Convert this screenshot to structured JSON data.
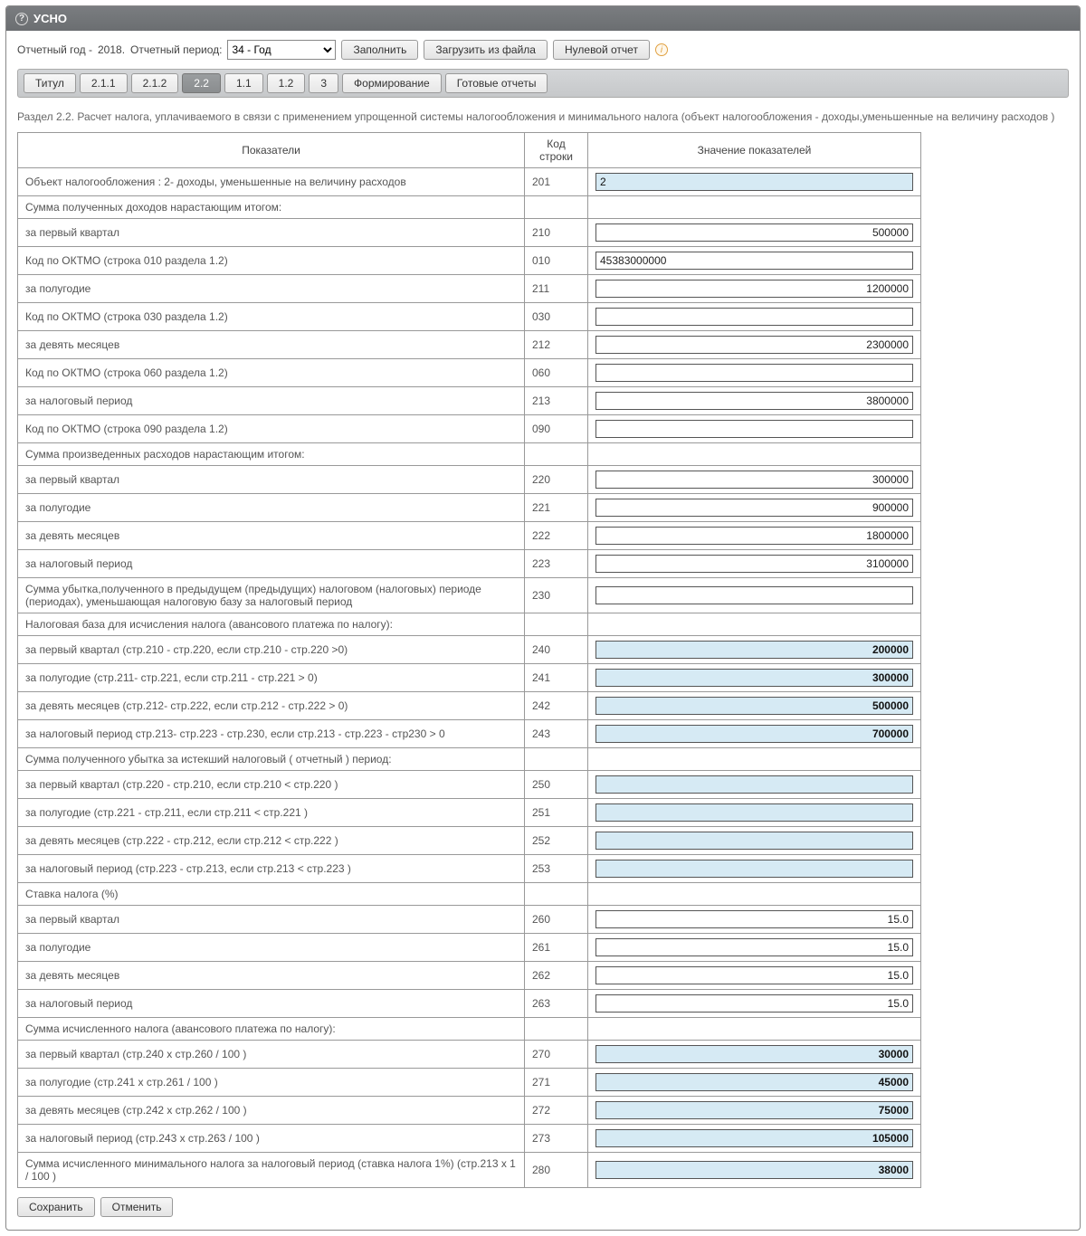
{
  "header": {
    "title": "УСНО"
  },
  "toolbar": {
    "year_label": "Отчетный год -",
    "year_value": "2018.",
    "period_label": "Отчетный период:",
    "period_selected": "34 - Год",
    "fill": "Заполнить",
    "load": "Загрузить из файла",
    "zero": "Нулевой отчет"
  },
  "tabs": [
    "Титул",
    "2.1.1",
    "2.1.2",
    "2.2",
    "1.1",
    "1.2",
    "3",
    "Формирование",
    "Готовые отчеты"
  ],
  "active_tab": "2.2",
  "section_title": "Раздел 2.2. Расчет налога, уплачиваемого в связи с применением упрощенной системы налогообложения и минимального налога (объект налогообложения - доходы,уменьшенные на величину расходов )",
  "cols": {
    "indicator": "Показатели",
    "code": "Код строки",
    "value": "Значение показателей"
  },
  "rows": [
    {
      "ind": "Объект налогообложения : 2- доходы, уменьшенные на величину расходов",
      "code": "201",
      "val": "2",
      "kind": "ro-left"
    },
    {
      "ind": "Сумма полученных доходов нарастающим итогом:",
      "code": "",
      "val": "",
      "kind": "header"
    },
    {
      "ind": "за первый квартал",
      "code": "210",
      "val": "500000",
      "kind": "edit-right"
    },
    {
      "ind": "Код по ОКТМО (строка 010 раздела 1.2)",
      "code": "010",
      "val": "45383000000",
      "kind": "edit-left"
    },
    {
      "ind": "за полугодие",
      "code": "211",
      "val": "1200000",
      "kind": "edit-right"
    },
    {
      "ind": "Код по ОКТМО (строка 030 раздела 1.2)",
      "code": "030",
      "val": "",
      "kind": "edit-left"
    },
    {
      "ind": "за девять месяцев",
      "code": "212",
      "val": "2300000",
      "kind": "edit-right"
    },
    {
      "ind": "Код по ОКТМО (строка 060 раздела 1.2)",
      "code": "060",
      "val": "",
      "kind": "edit-left"
    },
    {
      "ind": "за налоговый период",
      "code": "213",
      "val": "3800000",
      "kind": "edit-right"
    },
    {
      "ind": "Код по ОКТМО (строка 090 раздела 1.2)",
      "code": "090",
      "val": "",
      "kind": "edit-left"
    },
    {
      "ind": "Сумма произведенных расходов нарастающим итогом:",
      "code": "",
      "val": "",
      "kind": "header"
    },
    {
      "ind": "за первый квартал",
      "code": "220",
      "val": "300000",
      "kind": "edit-right"
    },
    {
      "ind": "за полугодие",
      "code": "221",
      "val": "900000",
      "kind": "edit-right"
    },
    {
      "ind": "за девять месяцев",
      "code": "222",
      "val": "1800000",
      "kind": "edit-right"
    },
    {
      "ind": "за налоговый период",
      "code": "223",
      "val": "3100000",
      "kind": "edit-right"
    },
    {
      "ind": "Сумма убытка,полученного в предыдущем (предыдущих) налоговом (налоговых) периоде (периодах), уменьшающая налоговую базу за налоговый период",
      "code": "230",
      "val": "",
      "kind": "edit-left"
    },
    {
      "ind": "Налоговая база для исчисления налога (авансового платежа по налогу):",
      "code": "",
      "val": "",
      "kind": "header"
    },
    {
      "ind": "за первый квартал (стр.210 - стр.220, если стр.210 - стр.220 >0)",
      "code": "240",
      "val": "200000",
      "kind": "ro-right"
    },
    {
      "ind": "за полугодие (стр.211- стр.221, если стр.211 - стр.221 > 0)",
      "code": "241",
      "val": "300000",
      "kind": "ro-right"
    },
    {
      "ind": "за девять месяцев (стр.212- стр.222, если стр.212 - стр.222 > 0)",
      "code": "242",
      "val": "500000",
      "kind": "ro-right"
    },
    {
      "ind": "за налоговый период стр.213- стр.223 - стр.230, если стр.213 - стр.223 - стр230 > 0",
      "code": "243",
      "val": "700000",
      "kind": "ro-right"
    },
    {
      "ind": "Сумма полученного убытка за истекший налоговый ( отчетный ) период:",
      "code": "",
      "val": "",
      "kind": "header"
    },
    {
      "ind": "за первый квартал (стр.220 - стр.210, если стр.210 < стр.220 )",
      "code": "250",
      "val": "",
      "kind": "ro-right"
    },
    {
      "ind": "за полугодие (стр.221 - стр.211, если стр.211 < стр.221 )",
      "code": "251",
      "val": "",
      "kind": "ro-right"
    },
    {
      "ind": "за девять месяцев (стр.222 - стр.212, если стр.212 < стр.222 )",
      "code": "252",
      "val": "",
      "kind": "ro-right"
    },
    {
      "ind": "за налоговый период (стр.223 - стр.213, если стр.213 < стр.223 )",
      "code": "253",
      "val": "",
      "kind": "ro-right"
    },
    {
      "ind": "Ставка налога (%)",
      "code": "",
      "val": "",
      "kind": "header"
    },
    {
      "ind": "за первый квартал",
      "code": "260",
      "val": "15.0",
      "kind": "edit-right"
    },
    {
      "ind": "за полугодие",
      "code": "261",
      "val": "15.0",
      "kind": "edit-right"
    },
    {
      "ind": "за девять месяцев",
      "code": "262",
      "val": "15.0",
      "kind": "edit-right"
    },
    {
      "ind": "за налоговый период",
      "code": "263",
      "val": "15.0",
      "kind": "edit-right"
    },
    {
      "ind": "Сумма исчисленного налога (авансового платежа по налогу):",
      "code": "",
      "val": "",
      "kind": "header"
    },
    {
      "ind": "за первый квартал (стр.240 х стр.260 / 100 )",
      "code": "270",
      "val": "30000",
      "kind": "ro-right"
    },
    {
      "ind": "за полугодие (стр.241 х стр.261 / 100 )",
      "code": "271",
      "val": "45000",
      "kind": "ro-right"
    },
    {
      "ind": "за девять месяцев (стр.242 х стр.262 / 100 )",
      "code": "272",
      "val": "75000",
      "kind": "ro-right"
    },
    {
      "ind": "за налоговый период (стр.243 х стр.263 / 100 )",
      "code": "273",
      "val": "105000",
      "kind": "ro-right"
    },
    {
      "ind": "Сумма исчисленного минимального налога за налоговый период (ставка налога 1%) (стр.213 х 1 / 100 )",
      "code": "280",
      "val": "38000",
      "kind": "ro-right"
    }
  ],
  "footer": {
    "save": "Сохранить",
    "cancel": "Отменить"
  }
}
